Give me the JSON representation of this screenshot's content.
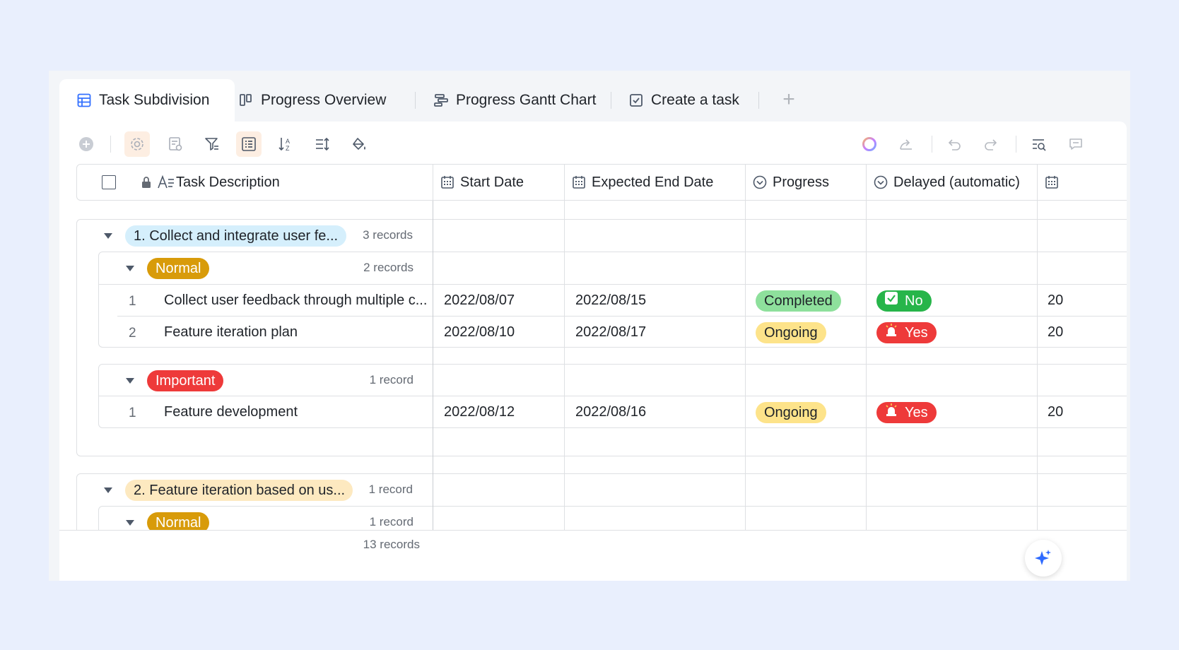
{
  "tabs": [
    {
      "label": "Task Subdivision",
      "icon": "grid-table-icon"
    },
    {
      "label": "Progress Overview",
      "icon": "kanban-icon"
    },
    {
      "label": "Progress Gantt Chart",
      "icon": "gantt-icon"
    },
    {
      "label": "Create a task",
      "icon": "form-check-icon"
    }
  ],
  "columns": [
    {
      "label": "Task Description",
      "icon": "text-field-icon"
    },
    {
      "label": "Start Date",
      "icon": "calendar-icon"
    },
    {
      "label": "Expected End Date",
      "icon": "calendar-icon"
    },
    {
      "label": "Progress",
      "icon": "single-select-icon"
    },
    {
      "label": "Delayed (automatic)",
      "icon": "single-select-icon"
    }
  ],
  "groups": [
    {
      "title": "1. Collect and integrate user fe...",
      "count": "3 records",
      "subgroups": [
        {
          "label": "Normal",
          "count": "2 records",
          "rows": [
            {
              "num": "1",
              "task": "Collect user feedback through multiple c...",
              "start": "2022/08/07",
              "end": "2022/08/15",
              "progress": "Completed",
              "delayed": "No",
              "extra": "20"
            },
            {
              "num": "2",
              "task": "Feature iteration plan",
              "start": "2022/08/10",
              "end": "2022/08/17",
              "progress": "Ongoing",
              "delayed": "Yes",
              "extra": "20"
            }
          ]
        },
        {
          "label": "Important",
          "count": "1 record",
          "rows": [
            {
              "num": "1",
              "task": "Feature development",
              "start": "2022/08/12",
              "end": "2022/08/16",
              "progress": "Ongoing",
              "delayed": "Yes",
              "extra": "20"
            }
          ]
        }
      ]
    },
    {
      "title": "2. Feature iteration based on us...",
      "count": "1 record",
      "subgroups": [
        {
          "label": "Normal",
          "count": "1 record",
          "rows": []
        }
      ]
    }
  ],
  "footer": {
    "count": "13 records"
  },
  "colors": {
    "group1": "#d5effc",
    "group2": "#fde9c0",
    "normal": "#d89b0a",
    "important": "#ee3a3a",
    "completed": "#8ee09c",
    "ongoing": "#fde38a",
    "no": "#27b54a",
    "yes": "#ee3a3a"
  }
}
